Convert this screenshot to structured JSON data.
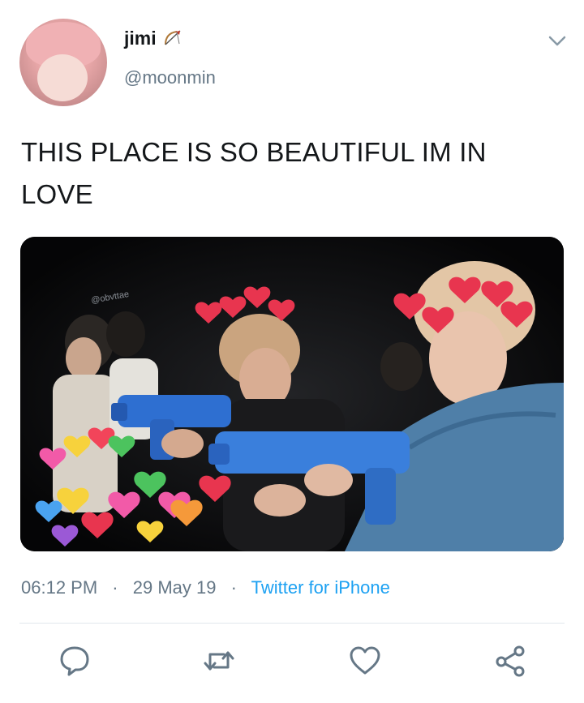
{
  "user": {
    "name": "jimi",
    "name_emoji": "bow-and-arrow-icon",
    "handle": "@moonmin"
  },
  "tweet": {
    "text": "THIS PLACE IS SO BEAUTIFUL IM IN LOVE",
    "media": {
      "watermark": "@obvttae"
    }
  },
  "meta": {
    "time": "06:12 PM",
    "date": "29 May 19",
    "source": "Twitter for iPhone"
  },
  "actions": [
    "reply-icon",
    "retweet-icon",
    "like-icon",
    "share-icon"
  ],
  "colors": {
    "text": "#14171a",
    "secondary": "#657786",
    "link": "#1da1f2",
    "divider": "#e1e8ed"
  }
}
